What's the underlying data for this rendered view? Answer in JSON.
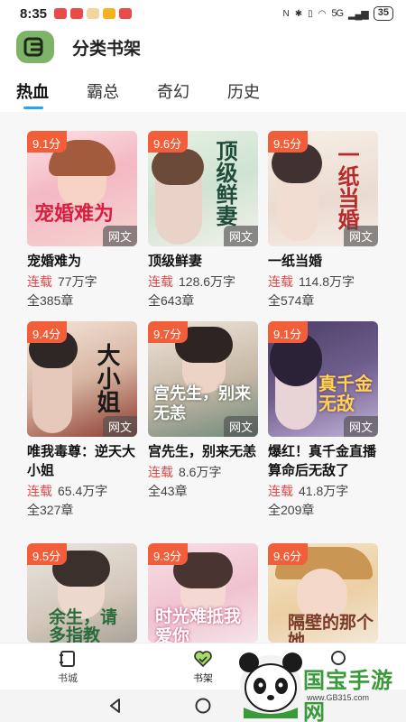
{
  "status_bar": {
    "time": "8:35",
    "battery": "35",
    "signal": "5G"
  },
  "header": {
    "title": "分类书架",
    "logo_icon": "book-shelf-icon"
  },
  "tabs": [
    {
      "label": "热血",
      "active": true
    },
    {
      "label": "霸总",
      "active": false
    },
    {
      "label": "奇幻",
      "active": false
    },
    {
      "label": "历史",
      "active": false
    }
  ],
  "books": [
    {
      "score": "9.1分",
      "tag": "网文",
      "cover_text": "宠婚难为",
      "title": "宠婚难为",
      "status": "连载",
      "words": "77万字",
      "chapters": "全385章"
    },
    {
      "score": "9.6分",
      "tag": "网文",
      "cover_text": "顶级鲜妻",
      "title": "顶级鲜妻",
      "status": "连载",
      "words": "128.6万字",
      "chapters": "全643章"
    },
    {
      "score": "9.5分",
      "tag": "网文",
      "cover_text": "一纸当婚",
      "title": "一纸当婚",
      "status": "连载",
      "words": "114.8万字",
      "chapters": "全574章"
    },
    {
      "score": "9.4分",
      "tag": "网文",
      "cover_text": "大小姐",
      "title": "唯我毒尊：逆天大小姐",
      "status": "连载",
      "words": "65.4万字",
      "chapters": "全327章"
    },
    {
      "score": "9.7分",
      "tag": "网文",
      "cover_text": "宫先生，别来无恙",
      "title": "宫先生，别来无恙",
      "status": "连载",
      "words": "8.6万字",
      "chapters": "全43章"
    },
    {
      "score": "9.1分",
      "tag": "网文",
      "cover_text": "真千金无敌",
      "title": "爆红！真千金直播算命后无敌了",
      "status": "连载",
      "words": "41.8万字",
      "chapters": "全209章"
    },
    {
      "score": "9.5分",
      "cover_text": "余生，请多指教"
    },
    {
      "score": "9.3分",
      "cover_text": "时光难抵我爱你"
    },
    {
      "score": "9.6分",
      "cover_text": "隔壁的那个她"
    }
  ],
  "bottom_nav": [
    {
      "label": "书城",
      "icon": "book-city-icon",
      "active": false
    },
    {
      "label": "书架",
      "icon": "heart-shelf-icon",
      "active": true
    },
    {
      "label": "",
      "icon": "profile-icon",
      "active": false
    }
  ],
  "watermark": {
    "text": "国宝手游网",
    "url": "www.GB315.com",
    "icon": "panda-logo"
  },
  "colors": {
    "accent": "#2aa6e8",
    "score_badge": "#f25d3a",
    "status_red": "#e04848",
    "logo_green": "#7fb36a"
  }
}
